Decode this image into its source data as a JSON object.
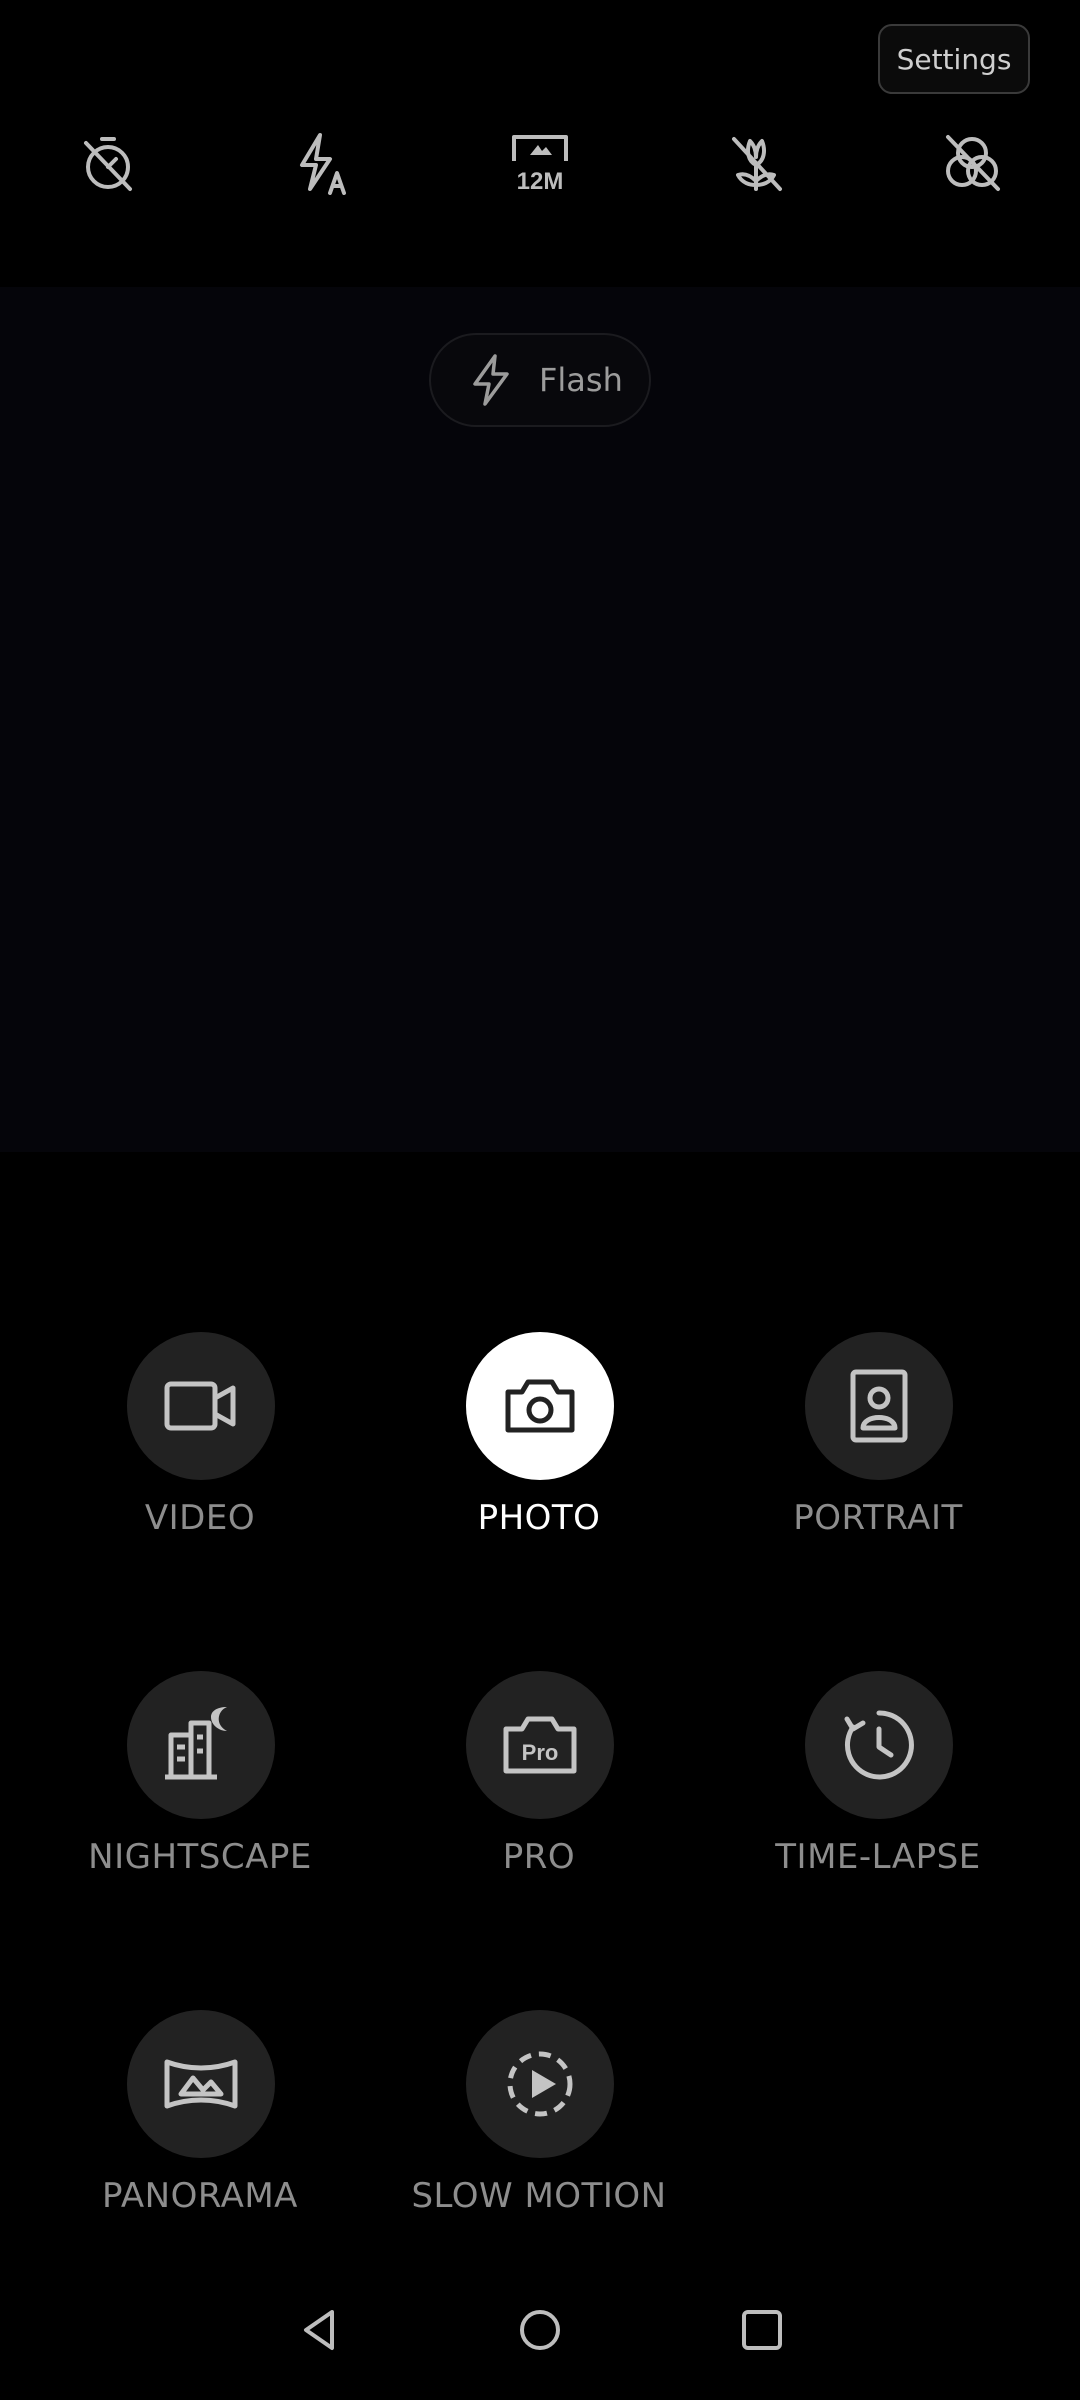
{
  "header": {
    "settings_label": "Settings",
    "toolbar_icons": [
      "timer-off-icon",
      "flash-auto-icon",
      "resolution-12m-icon",
      "macro-off-icon",
      "filter-off-icon"
    ],
    "resolution_text": "12M"
  },
  "viewfinder": {
    "flash_hint_label": "Flash"
  },
  "modes": [
    {
      "label": "VIDEO",
      "icon": "video-camera-icon",
      "active": false
    },
    {
      "label": "PHOTO",
      "icon": "camera-icon",
      "active": true
    },
    {
      "label": "PORTRAIT",
      "icon": "portrait-icon",
      "active": false
    },
    {
      "label": "NIGHTSCAPE",
      "icon": "nightscape-icon",
      "active": false
    },
    {
      "label": "PRO",
      "icon": "pro-camera-icon",
      "active": false
    },
    {
      "label": "TIME-LAPSE",
      "icon": "time-lapse-icon",
      "active": false
    },
    {
      "label": "PANORAMA",
      "icon": "panorama-icon",
      "active": false
    },
    {
      "label": "SLOW MOTION",
      "icon": "slow-motion-icon",
      "active": false
    }
  ],
  "nav": [
    "back-icon",
    "home-icon",
    "recents-icon"
  ],
  "colors": {
    "background": "#000000",
    "mode_button": "#222222",
    "active_mode_button": "#ffffff",
    "mode_label": "#8d8d8d",
    "active_mode_label": "#ffffff"
  }
}
